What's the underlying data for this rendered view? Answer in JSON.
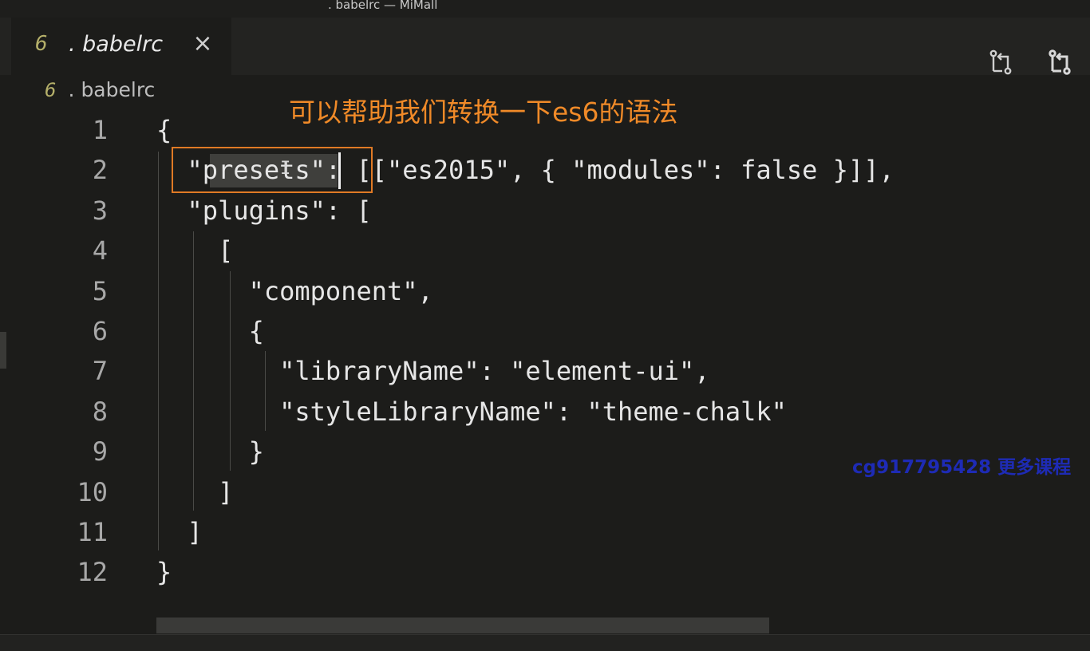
{
  "window": {
    "title": ". babelrc — MiMall"
  },
  "tab": {
    "icon": "6",
    "label": ". babelrc",
    "close": "×"
  },
  "toolbar": {
    "icons": [
      "source-control-compare-icon",
      "source-control-sync-icon"
    ]
  },
  "breadcrumb": {
    "icon": "6",
    "label": ". babelrc"
  },
  "annotation": "可以帮助我们转换一下es6的语法",
  "watermark": "cg917795428 更多课程",
  "lines": [
    {
      "n": "1",
      "text": "{"
    },
    {
      "n": "2",
      "text": "  \"presets\": [[\"es2015\", { \"modules\": false }]],"
    },
    {
      "n": "3",
      "text": "  \"plugins\": ["
    },
    {
      "n": "4",
      "text": "    ["
    },
    {
      "n": "5",
      "text": "      \"component\","
    },
    {
      "n": "6",
      "text": "      {"
    },
    {
      "n": "7",
      "text": "        \"libraryName\": \"element-ui\","
    },
    {
      "n": "8",
      "text": "        \"styleLibraryName\": \"theme-chalk\""
    },
    {
      "n": "9",
      "text": "      }"
    },
    {
      "n": "10",
      "text": "    ]"
    },
    {
      "n": "11",
      "text": "  ]"
    },
    {
      "n": "12",
      "text": "}"
    }
  ]
}
